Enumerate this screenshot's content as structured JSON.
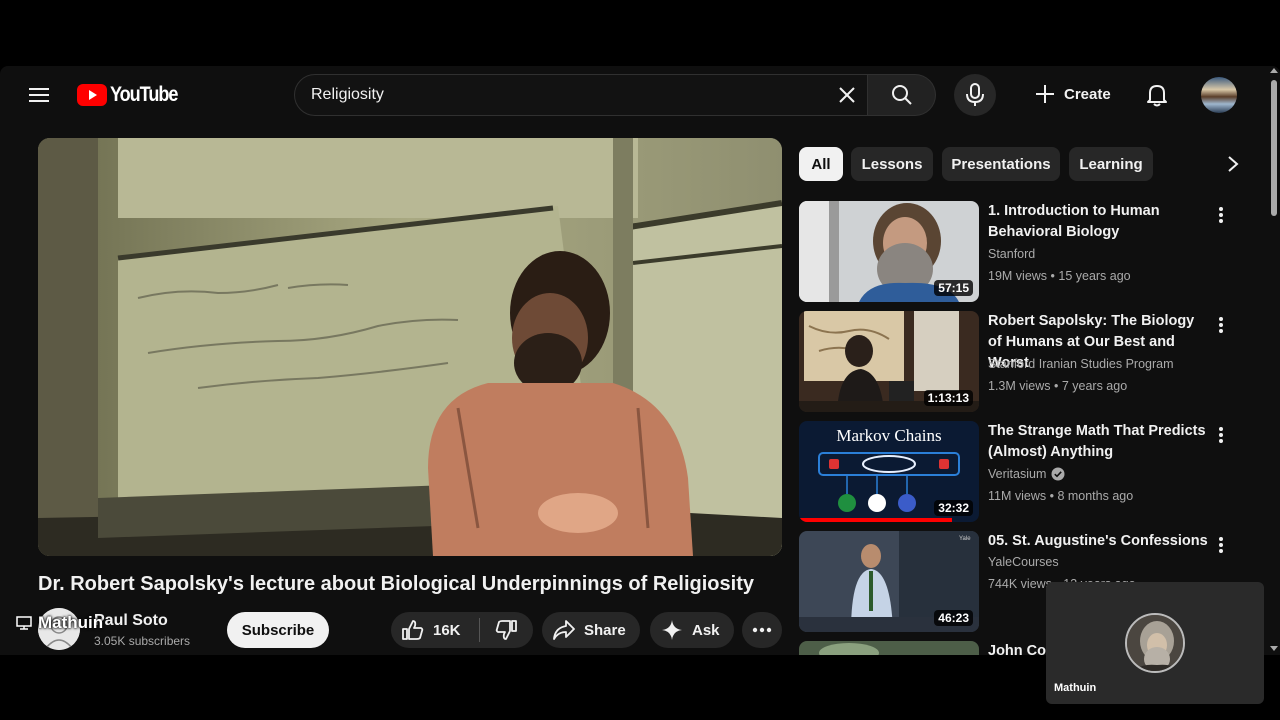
{
  "header": {
    "logo_text": "YouTube",
    "search_value": "Religiosity",
    "create_label": "Create"
  },
  "video": {
    "title": "Dr. Robert Sapolsky's lecture about Biological Underpinnings of Religiosity",
    "channel_name": "Paul Soto",
    "subscribers": "3.05K subscribers",
    "subscribe_label": "Subscribe",
    "likes": "16K",
    "share_label": "Share",
    "ask_label": "Ask"
  },
  "overlay": {
    "presenter_label": "Mathuin"
  },
  "chips": [
    {
      "label": "All",
      "active": true
    },
    {
      "label": "Lessons",
      "active": false
    },
    {
      "label": "Presentations",
      "active": false
    },
    {
      "label": "Learning",
      "active": false
    }
  ],
  "recommendations": [
    {
      "title": "1. Introduction to Human Behavioral Biology",
      "channel": "Stanford",
      "meta": "19M views • 15 years ago",
      "duration": "57:15",
      "verified": false
    },
    {
      "title": "Robert Sapolsky: The Biology of Humans at Our Best and Worst",
      "channel": "Stanford Iranian Studies Program",
      "meta": "1.3M views • 7 years ago",
      "duration": "1:13:13",
      "verified": false
    },
    {
      "title": "The Strange Math That Predicts (Almost) Anything",
      "channel": "Veritasium",
      "meta": "11M views • 8 months ago",
      "duration": "32:32",
      "verified": true,
      "thumb_text": "Markov Chains",
      "watched_fraction": 0.85
    },
    {
      "title": "05. St. Augustine's Confessions",
      "channel": "YaleCourses",
      "meta": "744K views • 13 years ago",
      "duration": "46:23",
      "verified": false,
      "thumb_text": "Yale"
    },
    {
      "title": "John Cor",
      "channel": "",
      "meta": "",
      "duration": "",
      "verified": false
    }
  ],
  "pip": {
    "name": "Mathuin"
  },
  "colors": {
    "background": "#0f0f0f",
    "accent_red": "#ff0000",
    "chip_bg": "#272727",
    "text_primary": "#f1f1f1",
    "text_secondary": "#aaaaaa"
  }
}
